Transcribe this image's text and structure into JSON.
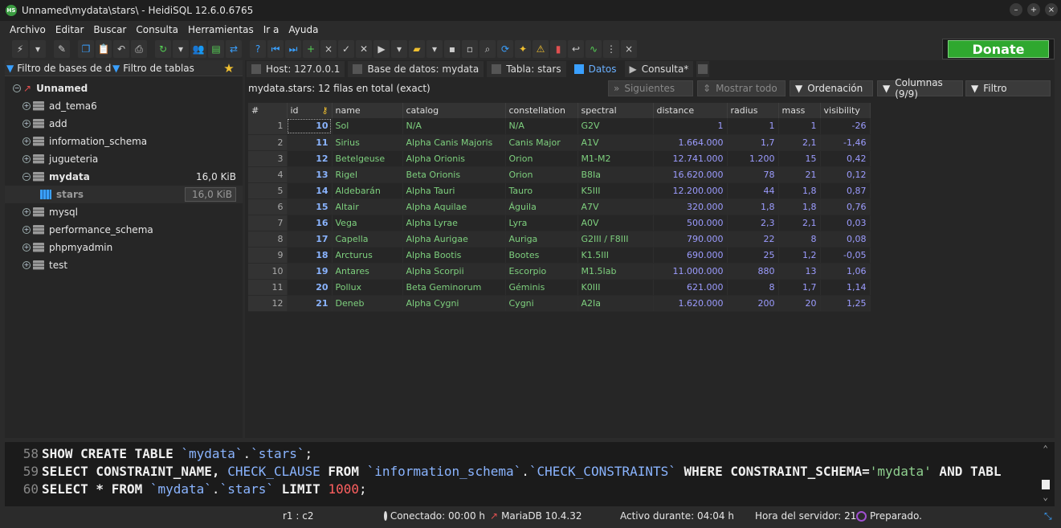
{
  "window": {
    "title": "Unnamed\\mydata\\stars\\ - HeidiSQL 12.6.0.6765",
    "controls": [
      "–",
      "+",
      "×"
    ]
  },
  "menu": [
    "Archivo",
    "Editar",
    "Buscar",
    "Consulta",
    "Herramientas",
    "Ir a",
    "Ayuda"
  ],
  "donate_label": "Donate",
  "left": {
    "db_filter": "Filtro de bases de dat",
    "table_filter": "Filtro de tablas",
    "root": "Unnamed",
    "databases": [
      {
        "name": "ad_tema6",
        "size": ""
      },
      {
        "name": "add",
        "size": ""
      },
      {
        "name": "information_schema",
        "size": ""
      },
      {
        "name": "jugueteria",
        "size": ""
      },
      {
        "name": "mydata",
        "size": "16,0 KiB",
        "expanded": true
      },
      {
        "name": "stars",
        "size": "16,0 KiB",
        "is_table": true
      },
      {
        "name": "mysql",
        "size": ""
      },
      {
        "name": "performance_schema",
        "size": ""
      },
      {
        "name": "phpmyadmin",
        "size": ""
      },
      {
        "name": "test",
        "size": ""
      }
    ]
  },
  "tabs": [
    "Host: 127.0.0.1",
    "Base de datos: mydata",
    "Tabla: stars",
    "Datos",
    "Consulta*"
  ],
  "grid_info": "mydata.stars: 12 filas en total (exact)",
  "grid_buttons": [
    "Siguientes",
    "Mostrar todo",
    "Ordenación",
    "Columnas (9/9)",
    "Filtro"
  ],
  "columns": [
    "#",
    "id",
    "name",
    "catalog",
    "constellation",
    "spectral",
    "distance",
    "radius",
    "mass",
    "visibility"
  ],
  "rows": [
    [
      "1",
      "10",
      "Sol",
      "N/A",
      "N/A",
      "G2V",
      "1",
      "1",
      "1",
      "-26"
    ],
    [
      "2",
      "11",
      "Sirius",
      "Alpha Canis Majoris",
      "Canis Major",
      "A1V",
      "1.664.000",
      "1,7",
      "2,1",
      "-1,46"
    ],
    [
      "3",
      "12",
      "Betelgeuse",
      "Alpha Orionis",
      "Orion",
      "M1-M2",
      "12.741.000",
      "1.200",
      "15",
      "0,42"
    ],
    [
      "4",
      "13",
      "Rigel",
      "Beta Orionis",
      "Orion",
      "B8Ia",
      "16.620.000",
      "78",
      "21",
      "0,12"
    ],
    [
      "5",
      "14",
      "Aldebarán",
      "Alpha Tauri",
      "Tauro",
      "K5III",
      "12.200.000",
      "44",
      "1,8",
      "0,87"
    ],
    [
      "6",
      "15",
      "Altair",
      "Alpha Aquilae",
      "Águila",
      "A7V",
      "320.000",
      "1,8",
      "1,8",
      "0,76"
    ],
    [
      "7",
      "16",
      "Vega",
      "Alpha Lyrae",
      "Lyra",
      "A0V",
      "500.000",
      "2,3",
      "2,1",
      "0,03"
    ],
    [
      "8",
      "17",
      "Capella",
      "Alpha Aurigae",
      "Auriga",
      "G2III / F8III",
      "790.000",
      "22",
      "8",
      "0,08"
    ],
    [
      "9",
      "18",
      "Arcturus",
      "Alpha Bootis",
      "Bootes",
      "K1.5III",
      "690.000",
      "25",
      "1,2",
      "-0,05"
    ],
    [
      "10",
      "19",
      "Antares",
      "Alpha Scorpii",
      "Escorpio",
      "M1.5Iab",
      "11.000.000",
      "880",
      "13",
      "1,06"
    ],
    [
      "11",
      "20",
      "Pollux",
      "Beta Geminorum",
      "Géminis",
      "K0III",
      "621.000",
      "8",
      "1,7",
      "1,14"
    ],
    [
      "12",
      "21",
      "Deneb",
      "Alpha Cygni",
      "Cygni",
      "A2Ia",
      "1.620.000",
      "200",
      "20",
      "1,25"
    ]
  ],
  "sql_log": [
    {
      "n": "58",
      "parts": [
        [
          "kw",
          "SHOW CREATE TABLE "
        ],
        [
          "id",
          "`mydata`"
        ],
        [
          "code",
          "."
        ],
        [
          "id",
          "`stars`"
        ],
        [
          "code",
          ";"
        ]
      ]
    },
    {
      "n": "59",
      "parts": [
        [
          "kw",
          "SELECT CONSTRAINT_NAME, "
        ],
        [
          "id",
          "CHECK_CLAUSE"
        ],
        [
          "kw",
          " FROM "
        ],
        [
          "id",
          "`information_schema`"
        ],
        [
          "code",
          "."
        ],
        [
          "id",
          "`CHECK_CONSTRAINTS`"
        ],
        [
          "kw",
          " WHERE CONSTRAINT_SCHEMA="
        ],
        [
          "str",
          "'mydata'"
        ],
        [
          "kw",
          " AND TABL"
        ]
      ]
    },
    {
      "n": "60",
      "parts": [
        [
          "kw",
          "SELECT * FROM "
        ],
        [
          "id",
          "`mydata`"
        ],
        [
          "code",
          "."
        ],
        [
          "id",
          "`stars`"
        ],
        [
          "kw",
          " LIMIT "
        ],
        [
          "numlit",
          "1000"
        ],
        [
          "code",
          ";"
        ]
      ]
    }
  ],
  "status": {
    "pos": "r1 : c2",
    "connected": "Conectado: 00:00 h",
    "server": "MariaDB 10.4.32",
    "uptime": "Activo durante: 04:04 h",
    "server_time": "Hora del servidor: 21:",
    "state": "Preparado."
  }
}
